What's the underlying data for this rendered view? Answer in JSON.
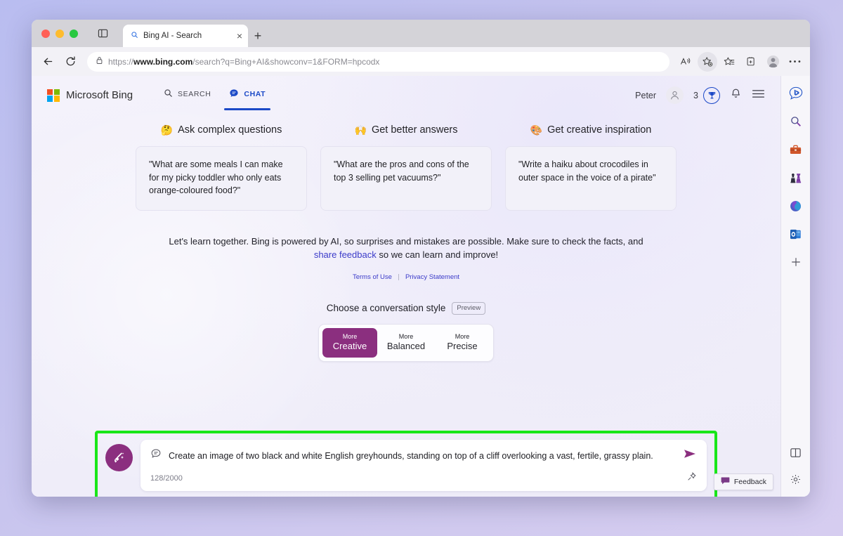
{
  "browser": {
    "tab": {
      "title": "Bing AI - Search",
      "close_label": "×",
      "favicon": "search-icon"
    },
    "new_tab_label": "+",
    "url": {
      "scheme": "https://",
      "host": "www.bing.com",
      "path": "/search?q=Bing+AI&showconv=1&FORM=hpcodx"
    },
    "toolbar_icons": [
      "read-aloud-icon",
      "add-favorite-icon",
      "favorites-icon",
      "collections-icon",
      "profile-avatar-icon",
      "more-options-icon"
    ],
    "nav_icons": [
      "back-arrow-icon",
      "reload-icon",
      "lock-icon"
    ]
  },
  "bing_header": {
    "brand": "Microsoft Bing",
    "tabs": [
      {
        "label": "SEARCH",
        "icon": "search-icon",
        "active": false
      },
      {
        "label": "CHAT",
        "icon": "chat-bubble-icon",
        "active": true
      }
    ],
    "username": "Peter",
    "rewards_count": "3",
    "icons": [
      "person-icon",
      "rewards-trophy-icon",
      "notification-bell-icon",
      "hamburger-menu-icon"
    ]
  },
  "suggestions": [
    {
      "emoji": "🤔",
      "heading": "Ask complex questions",
      "card": "\"What are some meals I can make for my picky toddler who only eats orange-coloured food?\""
    },
    {
      "emoji": "🙌",
      "heading": "Get better answers",
      "card": "\"What are the pros and cons of the top 3 selling pet vacuums?\""
    },
    {
      "emoji": "🎨",
      "heading": "Get creative inspiration",
      "card": "\"Write a haiku about crocodiles in outer space in the voice of a pirate\""
    }
  ],
  "disclaimer": {
    "text_before": "Let's learn together. Bing is powered by AI, so surprises and mistakes are possible. Make sure to check the facts, and ",
    "link": "share feedback",
    "text_after": " so we can learn and improve!"
  },
  "legal": {
    "terms": "Terms of Use",
    "privacy": "Privacy Statement"
  },
  "conversation_style": {
    "label": "Choose a conversation style",
    "preview_badge": "Preview",
    "options": [
      {
        "small": "More",
        "big": "Creative",
        "selected": true
      },
      {
        "small": "More",
        "big": "Balanced",
        "selected": false
      },
      {
        "small": "More",
        "big": "Precise",
        "selected": false
      }
    ]
  },
  "composer": {
    "new_topic_icon": "new-topic-broom-icon",
    "prompt_icon": "chat-prompt-icon",
    "text": "Create an image of two black and white English greyhounds, standing on top of a cliff overlooking a vast, fertile, grassy plain.",
    "char_count": "128/2000",
    "send_icon": "send-arrow-icon",
    "pin_icon": "pin-icon",
    "highlight_color": "#19e619"
  },
  "feedback": {
    "label": "Feedback",
    "icon": "feedback-bubble-icon"
  },
  "right_rail": {
    "items": [
      {
        "name": "bing-chat-icon"
      },
      {
        "name": "search-icon"
      },
      {
        "name": "briefcase-icon"
      },
      {
        "name": "games-chess-icon"
      },
      {
        "name": "microsoft-365-icon"
      },
      {
        "name": "outlook-icon"
      },
      {
        "name": "add-icon"
      }
    ],
    "bottom": [
      {
        "name": "split-screen-icon"
      },
      {
        "name": "settings-gear-icon"
      }
    ]
  },
  "colors": {
    "accent_purple": "#8b2f7f",
    "bing_blue": "#1b49c7",
    "highlight_green": "#19e619"
  }
}
